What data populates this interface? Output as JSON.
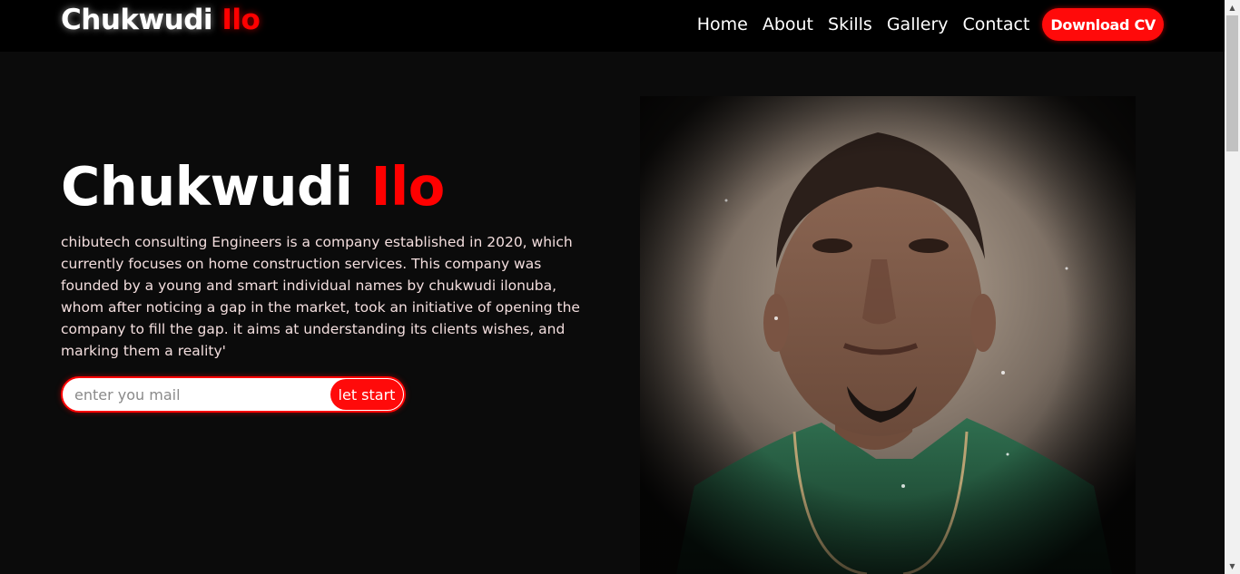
{
  "brand": {
    "first": "Chukwudi",
    "last": "Ilo",
    "accent_color": "#ff0000"
  },
  "nav": {
    "items": [
      {
        "label": "Home"
      },
      {
        "label": "About"
      },
      {
        "label": "Skills"
      },
      {
        "label": "Gallery"
      },
      {
        "label": "Contact"
      }
    ],
    "cv_button": "Download CV"
  },
  "hero": {
    "title_first": "Chukwudi",
    "title_last": "Ilo",
    "description": "chibutech consulting Engineers is a company established in 2020, which currently focuses on home construction services. This company was founded by a young and smart individual names by chukwudi ilonuba, whom after noticing a gap in the market, took an initiative of opening the company to fill the gap. it aims at understanding its clients wishes, and marking them a reality'",
    "email_placeholder": "enter you mail",
    "start_button": "let start"
  },
  "portrait": {
    "icon": "person-photo"
  }
}
